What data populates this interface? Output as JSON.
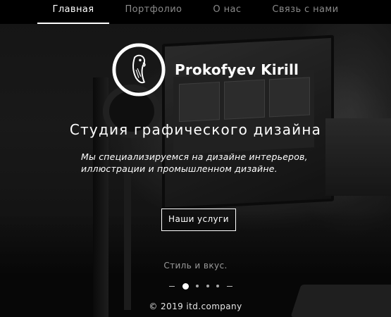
{
  "nav": {
    "items": [
      {
        "label": "Главная",
        "active": true
      },
      {
        "label": "Портфолио",
        "active": false
      },
      {
        "label": "О нас",
        "active": false
      },
      {
        "label": "Связь с нами",
        "active": false
      }
    ]
  },
  "logo": {
    "name": "Prokofyev Kirill",
    "icon": "parrot-logo-icon"
  },
  "hero": {
    "title": "Студия графического дизайна",
    "subtitle": "Мы специализируемся на дизайне интерьеров, иллюстрации и промышленном дизайне.",
    "cta_label": "Наши услуги",
    "tagline": "Стиль и вкус."
  },
  "pager": {
    "count": 4,
    "active_index": 0
  },
  "footer": {
    "copyright": "© 2019 itd.company"
  },
  "colors": {
    "nav_background": "#000000",
    "nav_inactive": "#8a8a8a",
    "text": "#ffffff"
  }
}
